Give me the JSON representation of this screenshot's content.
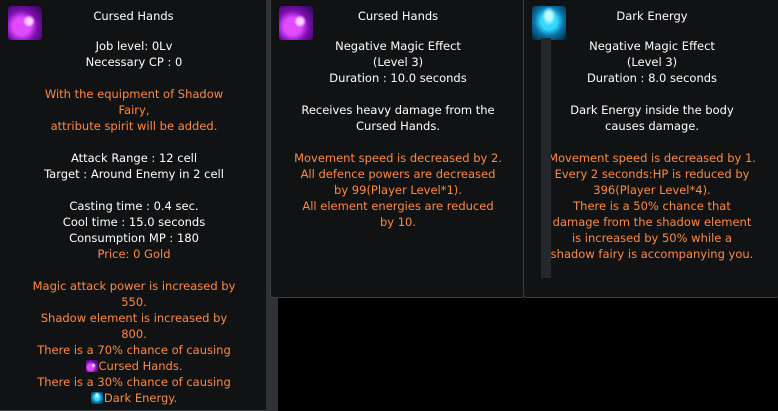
{
  "panel1": {
    "title": "Cursed Hands",
    "icon": "cursed-hands-icon",
    "job_level": "Job level: 0Lv",
    "necessary_cp": "Necessary CP : 0",
    "equip_note_1": "With the equipment of Shadow",
    "equip_note_2": "Fairy,",
    "equip_note_3": "attribute spirit will be added.",
    "attack_range": "Attack Range : 12 cell",
    "target": "Target : Around Enemy in 2 cell",
    "casting_time": "Casting time : 0.4 sec.",
    "cool_time": "Cool time : 15.0 seconds",
    "consumption_mp": "Consumption MP : 180",
    "price": "Price: 0 Gold",
    "effect_1": "Magic attack power is increased by",
    "effect_2": "550.",
    "effect_3": "Shadow element is increased by",
    "effect_4": "800.",
    "effect_5": "There is a 70% chance of causing",
    "effect_6": "Cursed Hands.",
    "effect_7": "There is a 30% chance of causing",
    "effect_8": "Dark Energy."
  },
  "panel2": {
    "title": "Cursed Hands",
    "icon": "cursed-hands-icon",
    "type": "Negative Magic Effect",
    "level": "(Level 3)",
    "duration": "Duration : 10.0 seconds",
    "desc_1": "Receives heavy damage from the",
    "desc_2": "Cursed Hands.",
    "effect_1": "Movement speed is decreased by 2.",
    "effect_2": "All defence powers are decreased",
    "effect_3": "by 99(Player Level*1).",
    "effect_4": "All element energies are reduced",
    "effect_5": "by 10."
  },
  "panel3": {
    "title": "Dark Energy",
    "icon": "dark-energy-icon",
    "type": "Negative Magic Effect",
    "level": "(Level 3)",
    "duration": "Duration : 8.0 seconds",
    "desc_1": "Dark Energy inside the body",
    "desc_2": "causes damage.",
    "effect_1": "Movement speed is decreased by 1.",
    "effect_2": "Every 2 seconds:HP is reduced by",
    "effect_3": "396(Player Level*4).",
    "effect_4": "There is a 50% chance that",
    "effect_5": "damage from the shadow element",
    "effect_6": "is increased by 50% while a",
    "effect_7": "shadow fairy is accompanying you."
  },
  "colors": {
    "text": "#ffffff",
    "highlight": "#ff8a3d",
    "panel": "#111214"
  }
}
